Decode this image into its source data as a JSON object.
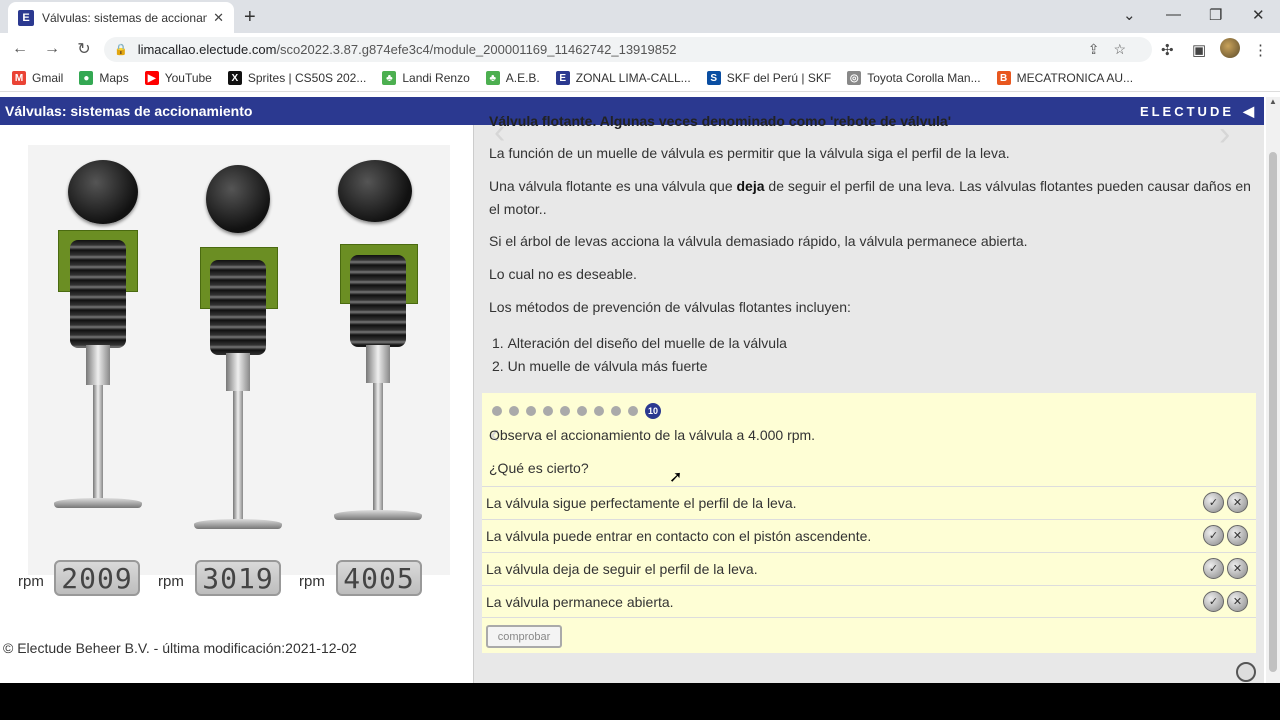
{
  "browser": {
    "tab_title": "Válvulas: sistemas de accionamie",
    "tab_icon": "E",
    "url_host": "limacallao.electude.com",
    "url_path": "/sco2022.3.87.g874efe3c4/module_200001169_11462742_13919852",
    "bookmarks": [
      {
        "label": "Gmail",
        "icon": "gmail-icon",
        "color": "#ea4335",
        "glyph": "M"
      },
      {
        "label": "Maps",
        "icon": "maps-icon",
        "color": "#34a853",
        "glyph": "●"
      },
      {
        "label": "YouTube",
        "icon": "youtube-icon",
        "color": "#ff0000",
        "glyph": "▶"
      },
      {
        "label": "Sprites | CS50S 202...",
        "icon": "x-icon",
        "color": "#111111",
        "glyph": "X"
      },
      {
        "label": "Landi Renzo",
        "icon": "leaf-icon",
        "color": "#4caf50",
        "glyph": "♣"
      },
      {
        "label": "A.E.B.",
        "icon": "leaf-icon",
        "color": "#4caf50",
        "glyph": "♣"
      },
      {
        "label": "ZONAL LIMA-CALL...",
        "icon": "electude-icon",
        "color": "#2b3990",
        "glyph": "E"
      },
      {
        "label": "SKF del Perú | SKF",
        "icon": "skf-icon",
        "color": "#0a4ea2",
        "glyph": "S"
      },
      {
        "label": "Toyota Corolla Man...",
        "icon": "toyota-icon",
        "color": "#888888",
        "glyph": "◎"
      },
      {
        "label": "MECATRONICA AU...",
        "icon": "b-icon",
        "color": "#e8571f",
        "glyph": "B"
      }
    ]
  },
  "header": {
    "title": "Válvulas: sistemas de accionamiento",
    "logo": "ELECTUDE"
  },
  "gauges": [
    {
      "label": "rpm",
      "value": "2009"
    },
    {
      "label": "rpm",
      "value": "3019"
    },
    {
      "label": "rpm",
      "value": "4005"
    }
  ],
  "footer": {
    "copyright": "© Electude Beheer B.V. - última modificación:2021-12-02"
  },
  "content": {
    "cut_heading": "Válvula flotante. Algunas veces denominado como 'rebote de válvula'",
    "p1": "La función de un muelle de válvula es permitir que la válvula siga el perfil de la leva.",
    "p2_before": "Una válvula flotante es una válvula que ",
    "p2_bold": "deja",
    "p2_after": " de seguir el perfil de una leva. Las válvulas flotantes pueden causar daños en el motor..",
    "p3": "Si el árbol de levas acciona la válvula demasiado rápido, la válvula permanece abierta.",
    "p4": "Lo cual no es deseable.",
    "p5": "Los métodos de prevención de válvulas flotantes incluyen:",
    "list": [
      "Alteración del diseño del muelle de la válvula",
      "Un muelle de válvula más fuerte"
    ]
  },
  "quiz": {
    "current_step": "10",
    "question": "Observa el accionamiento de la válvula a 4.000 rpm.",
    "prompt": "¿Qué es cierto?",
    "answers": [
      "La válvula sigue perfectamente el perfil de la leva.",
      "La válvula puede entrar en contacto con el pistón ascendente.",
      "La válvula deja de seguir el perfil de la leva.",
      "La válvula permanece abierta."
    ],
    "check_label": "comprobar"
  }
}
